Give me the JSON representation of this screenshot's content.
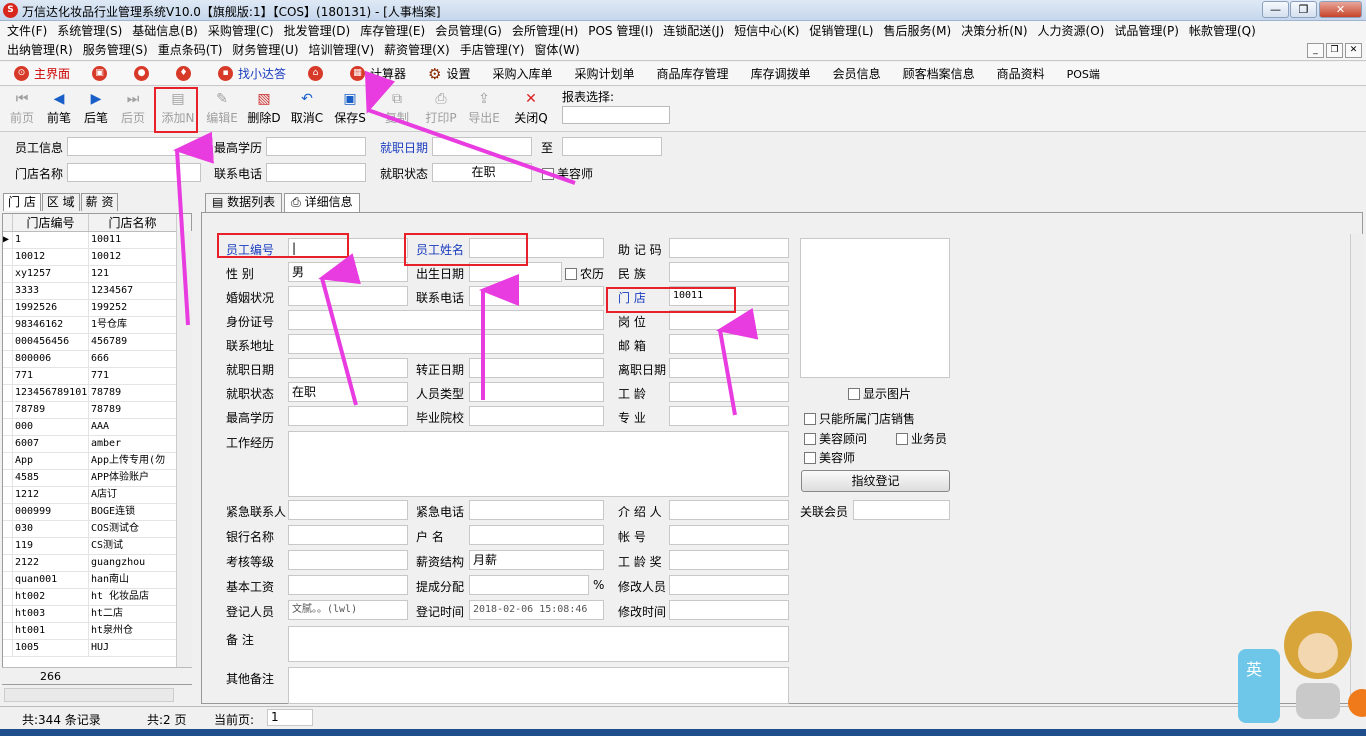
{
  "window": {
    "title": "万信达化妆品行业管理系统V10.0【旗舰版:1】【COS】(180131) - [人事档案]",
    "logo": "S",
    "minimize": "—",
    "maximize": "❐",
    "close": "✕"
  },
  "menu": {
    "row1": [
      "文件(F)",
      "系统管理(S)",
      "基础信息(B)",
      "采购管理(C)",
      "批发管理(D)",
      "库存管理(E)",
      "会员管理(G)",
      "会所管理(H)",
      "POS 管理(I)",
      "连锁配送(J)",
      "短信中心(K)",
      "促销管理(L)",
      "售后服务(M)",
      "决策分析(N)",
      "人力资源(O)",
      "试品管理(P)",
      "帐款管理(Q)"
    ],
    "row2": [
      "出纳管理(R)",
      "服务管理(S)",
      "重点条码(T)",
      "财务管理(U)",
      "培训管理(V)",
      "薪资管理(X)",
      "手店管理(Y)",
      "窗体(W)"
    ]
  },
  "shortcuts": [
    "主界面",
    "",
    "",
    "",
    "找小达答",
    "",
    "计算器",
    "设置",
    "采购入库单",
    "采购计划单",
    "商品库存管理",
    "库存调拨单",
    "会员信息",
    "顾客档案信息",
    "商品资料",
    "POS端"
  ],
  "toolbar": {
    "first": "前页",
    "prev": "前笔",
    "next": "后笔",
    "last": "后页",
    "add": "添加N",
    "edit": "编辑E",
    "delete": "删除D",
    "cancel": "取消C",
    "save": "保存S",
    "copy": "复制",
    "print": "打印P",
    "export": "导出E",
    "close": "关闭Q",
    "report_label": "报表选择:"
  },
  "filter": {
    "employee_info": "员工信息",
    "education": "最高学历",
    "hire_date": "就职日期",
    "to": "至",
    "store_name": "门店名称",
    "phone": "联系电话",
    "job_status": "就职状态",
    "job_status_value": "在职",
    "beautician": "美容师"
  },
  "left": {
    "tabs": [
      "门 店",
      "区 域",
      "薪 资"
    ],
    "columns": [
      "门店编号",
      "门店名称"
    ],
    "rows": [
      [
        "1",
        "10011"
      ],
      [
        "10012",
        "10012"
      ],
      [
        "xy1257",
        "121"
      ],
      [
        "3333",
        "1234567"
      ],
      [
        "1992526",
        "199252"
      ],
      [
        "98346162",
        "1号仓库"
      ],
      [
        "000456456",
        "456789"
      ],
      [
        "800006",
        "666"
      ],
      [
        "771",
        "771"
      ],
      [
        "123456789101",
        "78789"
      ],
      [
        "78789",
        "78789"
      ],
      [
        "000",
        "AAA"
      ],
      [
        "6007",
        "amber"
      ],
      [
        "App",
        "App上传专用(勿"
      ],
      [
        "4585",
        "APP体验账户"
      ],
      [
        "1212",
        "A店订"
      ],
      [
        "000999",
        "BOGE连锁"
      ],
      [
        "030",
        "COS测试仓"
      ],
      [
        "119",
        "CS测试"
      ],
      [
        "2122",
        "guangzhou"
      ],
      [
        "quan001",
        "han南山"
      ],
      [
        "ht002",
        "ht 化妆品店"
      ],
      [
        "ht003",
        "ht二店"
      ],
      [
        "ht001",
        "ht泉州仓"
      ],
      [
        "1005",
        "HUJ"
      ]
    ],
    "footer_count": "266"
  },
  "right_tabs": [
    "数据列表",
    "详细信息"
  ],
  "detail": {
    "emp_no": "员工编号",
    "emp_name": "员工姓名",
    "mnemonic": "助 记 码",
    "gender": "性 别",
    "gender_value": "男",
    "birthday": "出生日期",
    "lunar": "农历",
    "ethnicity": "民 族",
    "marital": "婚姻状况",
    "phone": "联系电话",
    "store": "门 店",
    "store_value": "10011",
    "id_no": "身份证号",
    "position": "岗 位",
    "address": "联系地址",
    "email": "邮 箱",
    "hire_date": "就职日期",
    "regular_date": "转正日期",
    "leave_date": "离职日期",
    "job_status": "就职状态",
    "job_status_value": "在职",
    "staff_type": "人员类型",
    "seniority": "工 龄",
    "education": "最高学历",
    "school": "毕业院校",
    "major": "专 业",
    "work_exp": "工作经历",
    "emergency_contact": "紧急联系人",
    "emergency_phone": "紧急电话",
    "referrer": "介 绍 人",
    "bank": "银行名称",
    "account_name": "户 名",
    "account_no": "帐 号",
    "grade": "考核等级",
    "salary_struct": "薪资结构",
    "salary_struct_value": "月薪",
    "seniority_bonus": "工 龄 奖",
    "base_salary": "基本工资",
    "commission": "提成分配",
    "percent": "%",
    "modifier": "修改人员",
    "registrar": "登记人员",
    "registrar_value": "文腻。。(lwl)",
    "reg_time": "登记时间",
    "reg_time_value": "2018-02-06 15:08:46",
    "mod_time": "修改时间",
    "remark": "备 注",
    "other_remark": "其他备注",
    "show_photo": "显示图片",
    "only_store_sales": "只能所属门店销售",
    "beauty_consultant": "美容顾问",
    "salesman": "业务员",
    "beautician": "美容师",
    "fingerprint": "指纹登记",
    "linked_member": "关联会员"
  },
  "status": {
    "total": "共:344 条记录",
    "pages": "共:2 页",
    "current_label": "当前页:",
    "current_value": "1"
  },
  "colors": {
    "accent_red": "#e8202a",
    "arrow_magenta": "#e83ce0",
    "label_blue": "#1a3cbf"
  }
}
